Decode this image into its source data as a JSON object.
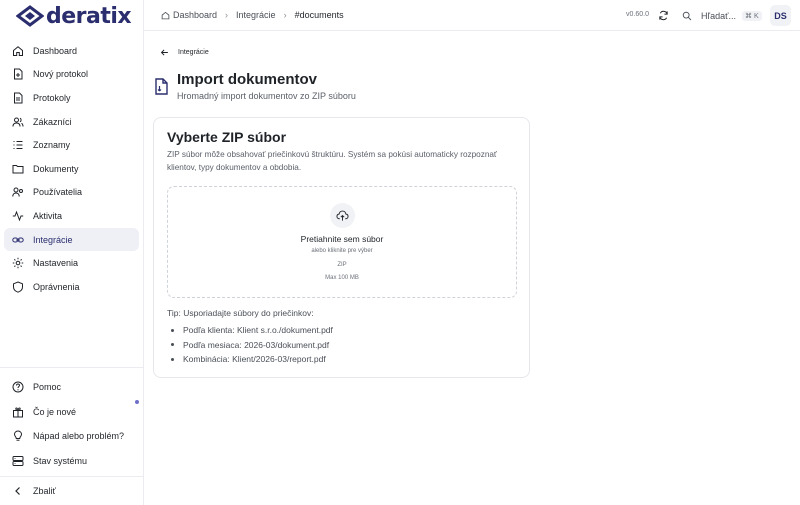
{
  "brand": {
    "name": "deratix",
    "color": "#2b2e6e"
  },
  "sidebar": {
    "items": [
      {
        "label": "Dashboard",
        "icon": "home-icon"
      },
      {
        "label": "Nový protokol",
        "icon": "file-plus-icon"
      },
      {
        "label": "Protokoly",
        "icon": "file-text-icon"
      },
      {
        "label": "Zákazníci",
        "icon": "users-icon"
      },
      {
        "label": "Zoznamy",
        "icon": "list-icon"
      },
      {
        "label": "Dokumenty",
        "icon": "folder-icon"
      },
      {
        "label": "Používatelia",
        "icon": "user-group-icon"
      },
      {
        "label": "Aktivita",
        "icon": "activity-icon"
      },
      {
        "label": "Integrácie",
        "icon": "link-icon",
        "active": true
      },
      {
        "label": "Nastavenia",
        "icon": "gear-icon"
      },
      {
        "label": "Oprávnenia",
        "icon": "shield-icon"
      }
    ],
    "bottom": [
      {
        "label": "Pomoc",
        "icon": "help-icon"
      },
      {
        "label": "Čo je nové",
        "icon": "gift-icon"
      },
      {
        "label": "Nápad alebo problém?",
        "icon": "lightbulb-icon"
      },
      {
        "label": "Stav systému",
        "icon": "server-icon"
      }
    ],
    "collapse_label": "Zbaliť"
  },
  "topbar": {
    "breadcrumb": [
      "Dashboard",
      "Integrácie",
      "#documents"
    ],
    "version": "v0.60.0",
    "search_label": "Hľadať...",
    "shortcut": "⌘ K",
    "avatar_initials": "DS"
  },
  "main": {
    "back_label": "Integrácie",
    "title": "Import dokumentov",
    "subtitle": "Hromadný import dokumentov zo ZIP súboru",
    "card": {
      "title": "Vyberte ZIP súbor",
      "description": "ZIP súbor môže obsahovať priečinkovú štruktúru. Systém sa pokúsi automaticky rozpoznať klientov, typy dokumentov a obdobia.",
      "dropzone": {
        "title": "Pretiahnite sem súbor",
        "subtitle": "alebo kliknite pre výber",
        "type": "ZIP",
        "max_size": "Max 100 MB"
      },
      "tip": "Tip: Usporiadajte súbory do priečinkov:",
      "tip_items": [
        "Podľa klienta: Klient s.r.o./dokument.pdf",
        "Podľa mesiaca: 2026-03/dokument.pdf",
        "Kombinácia: Klient/2026-03/report.pdf"
      ]
    }
  }
}
